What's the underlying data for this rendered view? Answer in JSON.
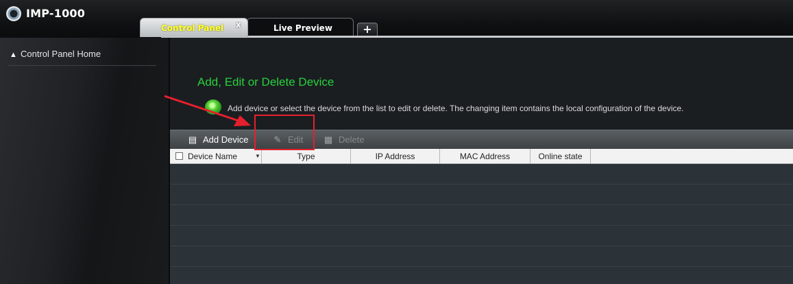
{
  "app": {
    "title": "IMP-1000",
    "logo_icon": "camera-icon"
  },
  "tabs": [
    {
      "label": "Control Panel",
      "active": true,
      "close_glyph": "x"
    },
    {
      "label": "Live Preview",
      "active": false
    }
  ],
  "add_tab_glyph": "+",
  "sidebar": {
    "items": [
      {
        "label": "Control Panel Home",
        "icon": "home-icon"
      }
    ]
  },
  "main": {
    "section_title": "Add, Edit or Delete Device",
    "info_text": "Add device or select the device from the list to edit or delete. The changing item contains the local configuration of the device.",
    "toolbar": {
      "add_label": "Add Device",
      "edit_label": "Edit",
      "delete_label": "Delete"
    },
    "table": {
      "columns": [
        "Device Name",
        "Type",
        "IP Address",
        "MAC Address",
        "Online state"
      ],
      "rows": []
    }
  },
  "colors": {
    "accent_green": "#27d13c",
    "active_tab_text": "#ffff33",
    "annotation_red": "#e5202c"
  }
}
